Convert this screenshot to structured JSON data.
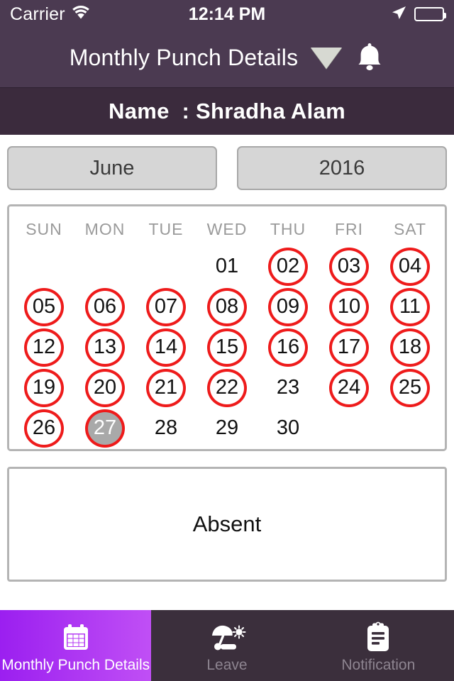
{
  "status_bar": {
    "carrier": "Carrier",
    "time": "12:14 PM",
    "wifi_icon": "wifi-icon",
    "location_icon": "location-arrow-icon",
    "battery_icon": "battery-full-icon"
  },
  "nav_bar": {
    "title": "Monthly Punch Details",
    "dropdown_icon": "triangle-down-icon",
    "notification_icon": "bell-icon"
  },
  "name_bar": {
    "label": "Name  : ",
    "value": "Shradha Alam",
    "full": "Name  : Shradha Alam"
  },
  "selectors": {
    "month": "June",
    "year": "2016"
  },
  "calendar": {
    "weekday_headers": [
      "SUN",
      "MON",
      "TUE",
      "WED",
      "THU",
      "FRI",
      "SAT"
    ],
    "weeks": [
      [
        {
          "label": "",
          "state": "empty"
        },
        {
          "label": "",
          "state": "empty"
        },
        {
          "label": "",
          "state": "empty"
        },
        {
          "label": "01",
          "state": "plain"
        },
        {
          "label": "02",
          "state": "marked"
        },
        {
          "label": "03",
          "state": "marked"
        },
        {
          "label": "04",
          "state": "marked"
        }
      ],
      [
        {
          "label": "05",
          "state": "marked"
        },
        {
          "label": "06",
          "state": "marked"
        },
        {
          "label": "07",
          "state": "marked"
        },
        {
          "label": "08",
          "state": "marked"
        },
        {
          "label": "09",
          "state": "marked"
        },
        {
          "label": "10",
          "state": "marked"
        },
        {
          "label": "11",
          "state": "marked"
        }
      ],
      [
        {
          "label": "12",
          "state": "marked"
        },
        {
          "label": "13",
          "state": "marked"
        },
        {
          "label": "14",
          "state": "marked"
        },
        {
          "label": "15",
          "state": "marked"
        },
        {
          "label": "16",
          "state": "marked"
        },
        {
          "label": "17",
          "state": "marked"
        },
        {
          "label": "18",
          "state": "marked"
        }
      ],
      [
        {
          "label": "19",
          "state": "marked"
        },
        {
          "label": "20",
          "state": "marked"
        },
        {
          "label": "21",
          "state": "marked"
        },
        {
          "label": "22",
          "state": "marked"
        },
        {
          "label": "23",
          "state": "plain"
        },
        {
          "label": "24",
          "state": "marked"
        },
        {
          "label": "25",
          "state": "marked"
        }
      ],
      [
        {
          "label": "26",
          "state": "marked"
        },
        {
          "label": "27",
          "state": "selected"
        },
        {
          "label": "28",
          "state": "plain"
        },
        {
          "label": "29",
          "state": "plain"
        },
        {
          "label": "30",
          "state": "plain"
        },
        {
          "label": "",
          "state": "empty"
        },
        {
          "label": "",
          "state": "empty"
        }
      ]
    ]
  },
  "detail_panel": {
    "status_text": "Absent"
  },
  "tab_bar": {
    "tabs": [
      {
        "label": "Monthly Punch Details",
        "icon": "calendar-icon",
        "active": true
      },
      {
        "label": "Leave",
        "icon": "beach-umbrella-icon",
        "active": false
      },
      {
        "label": "Notification",
        "icon": "clipboard-icon",
        "active": false
      }
    ]
  },
  "colors": {
    "nav_bar": "#4b3a51",
    "name_bar": "#3b2b3d",
    "tab_bar": "#3b2f3c",
    "accent_purple_start": "#9b1ff0",
    "accent_purple_end": "#c04ff5",
    "marker_red": "#ee1b1b",
    "selected_grey": "#a9a9a9"
  }
}
